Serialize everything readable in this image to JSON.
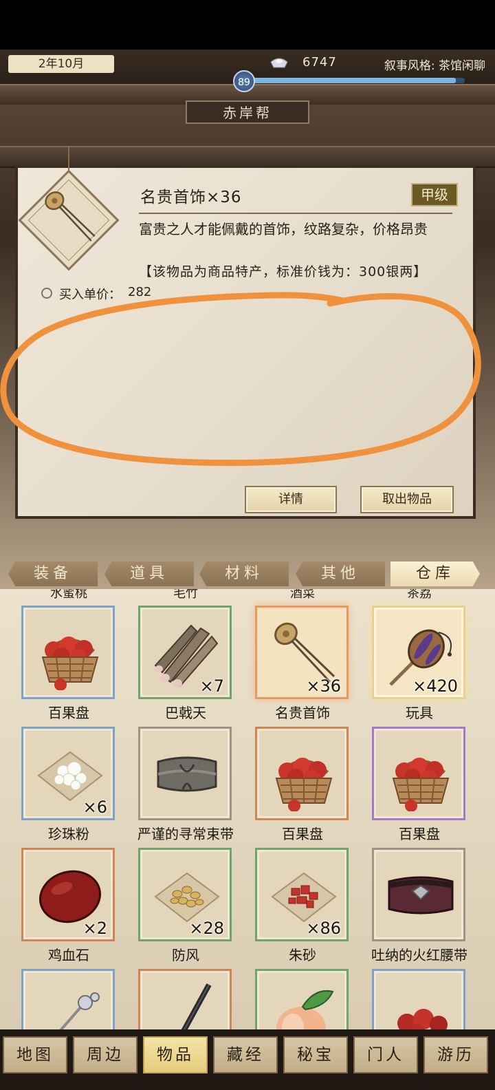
{
  "header": {
    "date": "2年10月",
    "silver": "6747",
    "narrative_style": "叙事风格: 茶馆闲聊",
    "level": "89",
    "level_progress": 0.96,
    "location": "赤岸帮"
  },
  "detail": {
    "name": "名贵首饰×36",
    "grade": "甲级",
    "description": "富贵之人才能佩戴的首饰，纹路复杂，价格昂贵",
    "note": "【该物品为商品特产，标准价钱为：300银两】",
    "buy_price_label": "买入单价：",
    "buy_price": "282",
    "buttons": {
      "details": "详情",
      "take_out": "取出物品"
    },
    "annotation_color": "#f0913e"
  },
  "tabs": [
    {
      "label": "装备",
      "active": false
    },
    {
      "label": "道具",
      "active": false
    },
    {
      "label": "材料",
      "active": false
    },
    {
      "label": "其他",
      "active": false
    },
    {
      "label": "仓库",
      "active": true
    }
  ],
  "partial_labels": [
    "水蜜桃",
    "毛竹",
    "酒菜",
    "茶荔"
  ],
  "items": [
    {
      "name": "百果盘",
      "qty": "",
      "icon": "fruit-basket-icon",
      "rarity": "blue"
    },
    {
      "name": "巴戟天",
      "qty": "×7",
      "icon": "root-sticks-icon",
      "rarity": "green"
    },
    {
      "name": "名贵首饰",
      "qty": "×36",
      "icon": "hairpin-icon",
      "rarity": "selected"
    },
    {
      "name": "玩具",
      "qty": "×420",
      "icon": "rattle-drum-icon",
      "rarity": "gold"
    },
    {
      "name": "珍珠粉",
      "qty": "×6",
      "icon": "pearl-powder-icon",
      "rarity": "blue"
    },
    {
      "name": "严谨的寻常束带",
      "qty": "",
      "icon": "belt-icon",
      "rarity": "gray"
    },
    {
      "name": "百果盘",
      "qty": "",
      "icon": "fruit-basket-icon",
      "rarity": "orange"
    },
    {
      "name": "百果盘",
      "qty": "",
      "icon": "fruit-basket-icon",
      "rarity": "purple"
    },
    {
      "name": "鸡血石",
      "qty": "×2",
      "icon": "red-stone-icon",
      "rarity": "orange"
    },
    {
      "name": "防风",
      "qty": "×28",
      "icon": "seeds-icon",
      "rarity": "green"
    },
    {
      "name": "朱砂",
      "qty": "×86",
      "icon": "cinnabar-icon",
      "rarity": "green"
    },
    {
      "name": "吐纳的火红腰带",
      "qty": "",
      "icon": "red-sash-icon",
      "rarity": "gray"
    },
    {
      "name": "",
      "qty": "",
      "icon": "silver-hairpin-icon",
      "rarity": "blue"
    },
    {
      "name": "",
      "qty": "",
      "icon": "dark-staff-icon",
      "rarity": "orange"
    },
    {
      "name": "",
      "qty": "",
      "icon": "peach-icon",
      "rarity": "green"
    },
    {
      "name": "",
      "qty": "",
      "icon": "dates-bowl-icon",
      "rarity": "blue"
    }
  ],
  "nav": [
    {
      "label": "地图",
      "active": false
    },
    {
      "label": "周边",
      "active": false
    },
    {
      "label": "物品",
      "active": true
    },
    {
      "label": "藏经",
      "active": false
    },
    {
      "label": "秘宝",
      "active": false
    },
    {
      "label": "门人",
      "active": false
    },
    {
      "label": "游历",
      "active": false
    }
  ]
}
